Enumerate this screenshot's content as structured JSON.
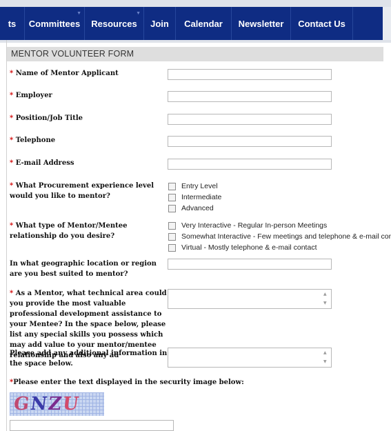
{
  "nav": {
    "items": [
      {
        "label": "ts"
      },
      {
        "label": "Committees"
      },
      {
        "label": "Resources"
      },
      {
        "label": "Join"
      },
      {
        "label": "Calendar"
      },
      {
        "label": "Newsletter"
      },
      {
        "label": "Contact Us"
      }
    ]
  },
  "form": {
    "title": "MENTOR VOLUNTEER FORM",
    "required_marker": "*",
    "fields": {
      "name": {
        "label": "Name of Mentor Applicant",
        "value": ""
      },
      "employer": {
        "label": "Employer",
        "value": ""
      },
      "position": {
        "label": "Position/Job Title",
        "value": ""
      },
      "telephone": {
        "label": "Telephone",
        "value": ""
      },
      "email": {
        "label": "E-mail Address",
        "value": ""
      }
    },
    "experience": {
      "label": "What Procurement experience level would you like to mentor?",
      "options": [
        "Entry Level",
        "Intermediate",
        "Advanced"
      ]
    },
    "relationship": {
      "label": "What type of Mentor/Mentee relationship do you desire?",
      "options": [
        "Very Interactive - Regular In-person Meetings",
        "Somewhat Interactive - Few meetings and telephone & e-mail contact",
        "Virtual - Mostly telephone & e-mail contact"
      ]
    },
    "location": {
      "label": "In what geographic location or region are you best suited to mentor?",
      "value": ""
    },
    "technical": {
      "label": "As a Mentor, what technical area could you provide the most valuable professional development assistance to your Mentee? In the space below, please list any special skills you possess which may add value to your mentor/mentee relationship and also any ad",
      "value": ""
    },
    "additional": {
      "label": "Please add any additional information in the space below.",
      "value": ""
    },
    "security": {
      "label": "Please enter the text displayed in the security image below:",
      "captcha_text": "GNZU",
      "value": ""
    }
  }
}
